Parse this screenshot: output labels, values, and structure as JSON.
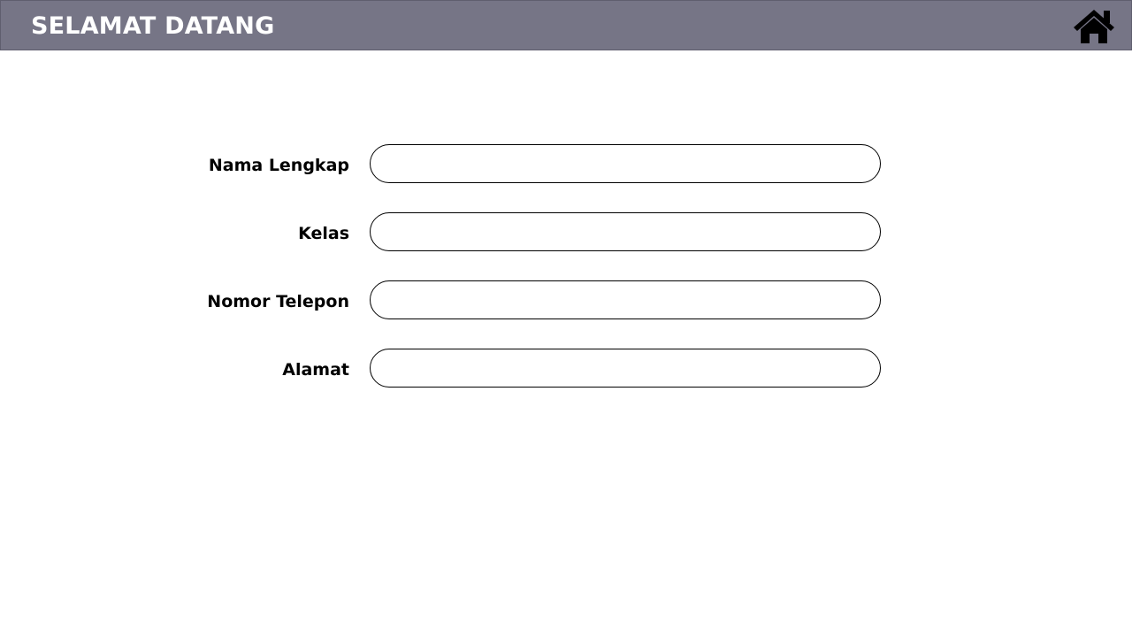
{
  "header": {
    "title": "SELAMAT DATANG",
    "home_icon": "home-icon"
  },
  "form": {
    "fields": [
      {
        "label": "Nama Lengkap",
        "value": "",
        "placeholder": ""
      },
      {
        "label": "Kelas",
        "value": "",
        "placeholder": ""
      },
      {
        "label": "Nomor Telepon",
        "value": "",
        "placeholder": ""
      },
      {
        "label": "Alamat",
        "value": "",
        "placeholder": ""
      }
    ]
  },
  "colors": {
    "header_bg": "#767586",
    "header_text": "#ffffff",
    "input_border": "#000000"
  }
}
